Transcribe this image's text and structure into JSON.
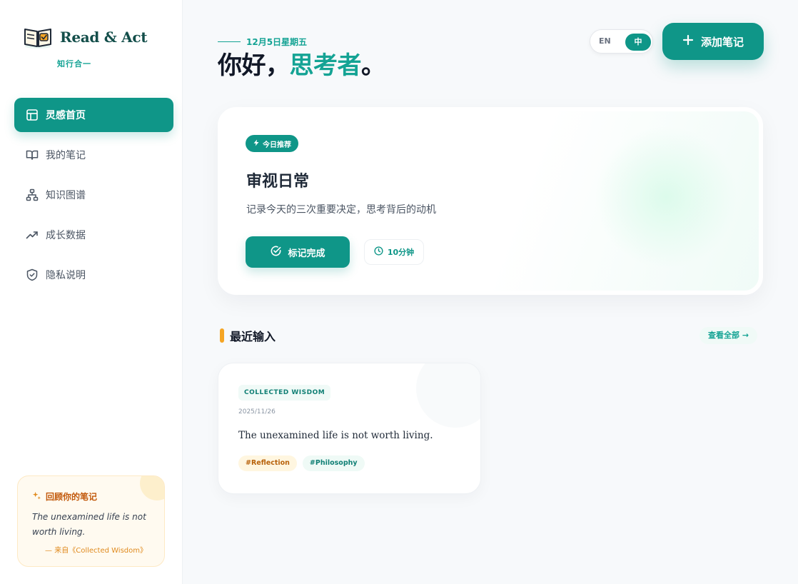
{
  "brand": {
    "name": "Read & Act",
    "subtitle": "知行合一"
  },
  "sidebar": {
    "items": [
      {
        "label": "灵感首页",
        "icon": "layout-icon",
        "active": true
      },
      {
        "label": "我的笔记",
        "icon": "book-open-icon",
        "active": false
      },
      {
        "label": "知识图谱",
        "icon": "hierarchy-icon",
        "active": false
      },
      {
        "label": "成长数据",
        "icon": "trending-up-icon",
        "active": false
      },
      {
        "label": "隐私说明",
        "icon": "shield-icon",
        "active": false
      }
    ],
    "memory": {
      "title": "回顾你的笔记",
      "quote": "The unexamined life is not worth living.",
      "source": "— 来自《Collected Wisdom》"
    }
  },
  "header": {
    "date": "12月5日星期五",
    "greeting_prefix": "你好，",
    "greeting_name": "思考者",
    "greeting_suffix": "。",
    "lang_en": "EN",
    "lang_zh": "中",
    "add_note_label": "添加笔记"
  },
  "recommendation": {
    "badge": "今日推荐",
    "title": "审视日常",
    "description": "记录今天的三次重要决定，思考背后的动机",
    "done_label": "标记完成",
    "duration": "10分钟"
  },
  "recent": {
    "title": "最近输入",
    "view_all": "查看全部 →",
    "notes": [
      {
        "category": "COLLECTED WISDOM",
        "date": "2025/11/26",
        "text": "The unexamined life is not worth living.",
        "tags": [
          "#Reflection",
          "#Philosophy"
        ]
      }
    ]
  },
  "colors": {
    "primary": "#0f9688",
    "accent": "#14a394",
    "highlight": "#f5a524"
  }
}
